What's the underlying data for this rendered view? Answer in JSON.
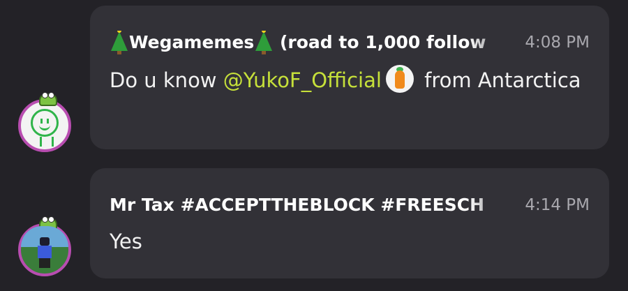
{
  "messages": [
    {
      "sender_name": "Wegamemes",
      "sender_suffix": " (road to 1,000 follow",
      "time": "4:08 PM",
      "body_pre": "Do u know ",
      "mention": "@YukoF_Official",
      "body_post": " from Antarctica",
      "avatar_icon": "stick-figure-avatar",
      "inline_icon": "carrot-avatar"
    },
    {
      "sender": "Mr Tax #ACCEPTTHEBLOCK #FREESCH",
      "time": "4:14 PM",
      "body": "Yes",
      "avatar_icon": "roblox-character-avatar"
    }
  ],
  "colors": {
    "background": "#232227",
    "bubble": "#323137",
    "mention": "#c6e03a",
    "timestamp": "#a9a8ae",
    "avatar_ring": "#b84db0"
  }
}
